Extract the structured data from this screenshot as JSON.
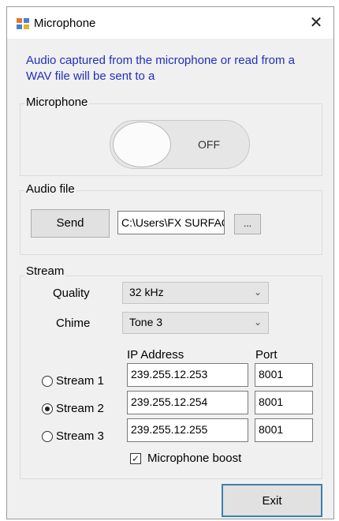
{
  "window": {
    "title": "Microphone",
    "close_glyph": "✕",
    "app_icon": "app-icon"
  },
  "description": "Audio captured from the microphone or read from a WAV file will be sent to a",
  "microphone_group": {
    "label": "Microphone",
    "toggle_state": "OFF"
  },
  "audio_file_group": {
    "label": "Audio file",
    "send_label": "Send",
    "path_value": "C:\\Users\\FX SURFACE",
    "browse_label": "..."
  },
  "stream_group": {
    "label": "Stream",
    "quality_label": "Quality",
    "quality_value": "32 kHz",
    "chime_label": "Chime",
    "chime_value": "Tone 3",
    "ip_header": "IP Address",
    "port_header": "Port",
    "streams": [
      {
        "label": "Stream 1",
        "ip": "239.255.12.253",
        "port": "8001"
      },
      {
        "label": "Stream 2",
        "ip": "239.255.12.254",
        "port": "8001"
      },
      {
        "label": "Stream 3",
        "ip": "239.255.12.255",
        "port": "8001"
      }
    ],
    "selected_stream": 2,
    "boost_label": "Microphone boost",
    "boost_checked": true
  },
  "exit_label": "Exit"
}
